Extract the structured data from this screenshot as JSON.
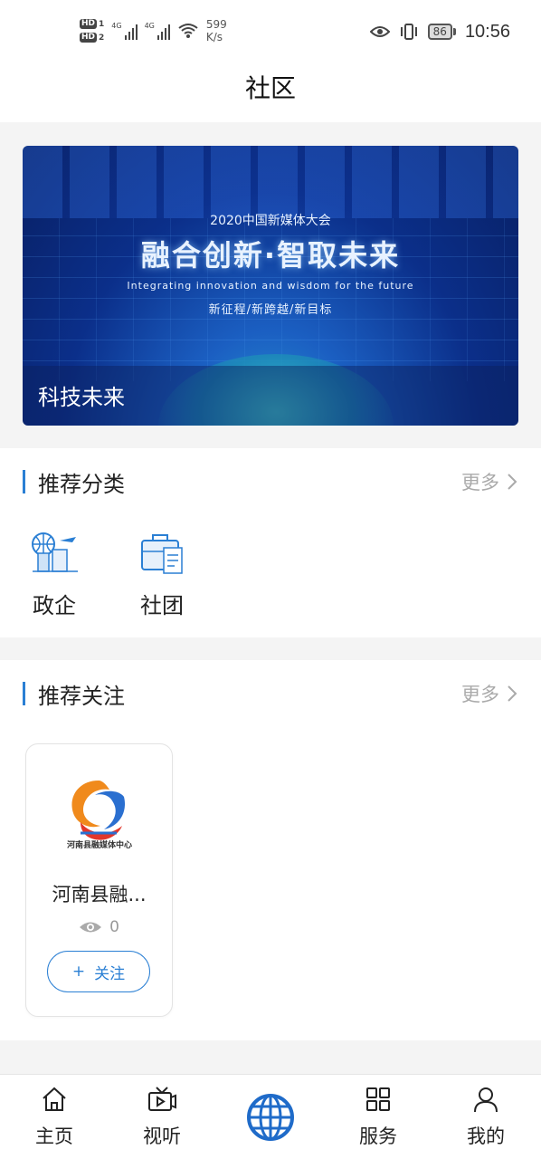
{
  "status_bar": {
    "hd1": "HD",
    "hd1_sub": "1",
    "hd2": "HD",
    "hd2_sub": "2",
    "net1": "4G",
    "net2": "4G",
    "speed_value": "599",
    "speed_unit": "K/s",
    "battery": "86",
    "time": "10:56"
  },
  "header": {
    "title": "社区"
  },
  "banner": {
    "subtitle": "2020中国新媒体大会",
    "headline": "融合创新·智取未来",
    "english": "Integrating innovation and wisdom for the future",
    "slogan": "新征程/新跨越/新目标",
    "caption": "科技未来"
  },
  "recommended_categories": {
    "title": "推荐分类",
    "more": "更多",
    "items": [
      {
        "label": "政企",
        "icon": "globe-buildings-icon"
      },
      {
        "label": "社团",
        "icon": "briefcase-icon"
      }
    ]
  },
  "recommended_follow": {
    "title": "推荐关注",
    "more": "更多",
    "cards": [
      {
        "name": "河南县融...",
        "logo_text": "河南县融媒体中心",
        "views": "0",
        "follow_label": "关注",
        "follow_icon": "+"
      }
    ]
  },
  "bottom_nav": {
    "items": [
      {
        "label": "主页",
        "icon": "home-icon"
      },
      {
        "label": "视听",
        "icon": "video-icon"
      },
      {
        "label": "",
        "icon": "globe-icon"
      },
      {
        "label": "服务",
        "icon": "grid-icon"
      },
      {
        "label": "我的",
        "icon": "user-icon"
      }
    ]
  },
  "colors": {
    "accent": "#2a7fd4",
    "background": "#f4f4f4",
    "muted": "#aaaaaa"
  }
}
